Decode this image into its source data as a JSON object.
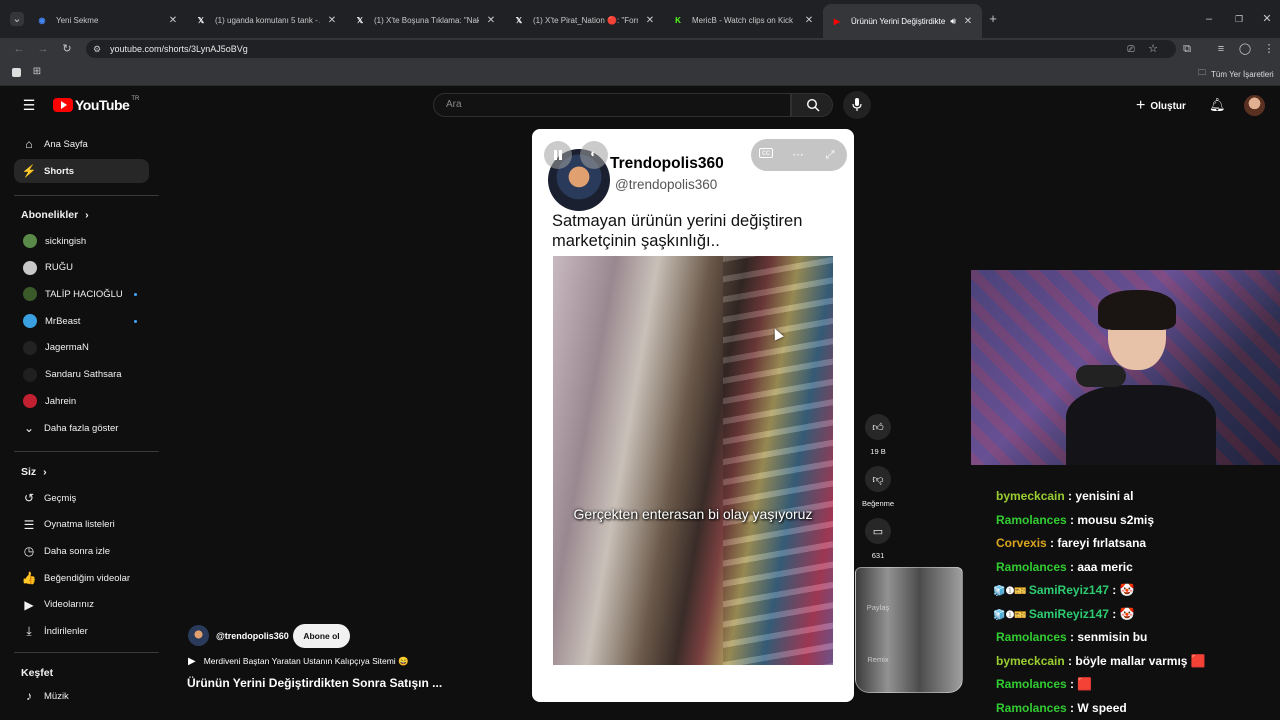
{
  "browser": {
    "tabs": [
      {
        "title": "Yeni Sekme",
        "favicon": "chrome",
        "active": false
      },
      {
        "title": "(1) uganda komutanı 5 tank - A",
        "favicon": "x",
        "active": false
      },
      {
        "title": "(1) X'te Boşuna Tıklama: \"Nakit",
        "favicon": "x",
        "active": false
      },
      {
        "title": "(1) X'te Pirat_Nation 🔴: \"Form",
        "favicon": "x",
        "active": false
      },
      {
        "title": "MericB - Watch clips on Kick",
        "favicon": "kick",
        "active": false
      },
      {
        "title": "Ürünün Yerini Değiştirdikte",
        "favicon": "youtube",
        "active": true
      }
    ],
    "url": "youtube.com/shorts/3LynAJ5oBVg",
    "bookmarks_label": "Tüm Yer İşaretleri"
  },
  "youtube": {
    "logo_text": "YouTube",
    "region": "TR",
    "search_placeholder": "Ara",
    "create_label": "Oluştur"
  },
  "sidebar": {
    "main": [
      {
        "label": "Ana Sayfa",
        "icon": "home-icon",
        "glyph": "⌂"
      },
      {
        "label": "Shorts",
        "icon": "shorts-icon",
        "glyph": "⚡"
      }
    ],
    "subscriptions_title": "Abonelikler",
    "subscriptions": [
      {
        "label": "sickingish",
        "color": "#5a8a4a",
        "live": false
      },
      {
        "label": "RUĞU",
        "color": "#c8c8c8",
        "live": false
      },
      {
        "label": "TALİP HACIOĞLU",
        "color": "#3a5a2a",
        "live": true
      },
      {
        "label": "MrBeast",
        "color": "#3aa0e0",
        "live": true
      },
      {
        "label": "JagermaN",
        "color": "#222222",
        "live": false
      },
      {
        "label": "Sandaru Sathsara",
        "color": "#202020",
        "live": false
      },
      {
        "label": "Jahrein",
        "color": "#c02030",
        "live": false
      }
    ],
    "show_more": "Daha fazla göster",
    "you_title": "Siz",
    "you_items": [
      {
        "label": "Geçmiş",
        "glyph": "↺"
      },
      {
        "label": "Oynatma listeleri",
        "glyph": "☰"
      },
      {
        "label": "Daha sonra izle",
        "glyph": "◷"
      },
      {
        "label": "Beğendiğim videolar",
        "glyph": "👍"
      },
      {
        "label": "Videolarınız",
        "glyph": "▶"
      },
      {
        "label": "İndirilenler",
        "glyph": "⤓"
      }
    ],
    "explore_title": "Keşfet",
    "explore_items": [
      {
        "label": "Müzik",
        "glyph": "♪"
      }
    ]
  },
  "short": {
    "channel_name": "Trendopolis360",
    "channel_handle": "@trendopolis360",
    "title": "Satmayan ürünün yerini değiştiren marketçinin şaşkınlığı..",
    "caption": "Gerçekten enterasan bi olay yaşıyoruz",
    "likes": "19 B",
    "dislike_label": "Beğenme",
    "comments": "631",
    "share_label": "Paylaş",
    "remix_label": "Remix"
  },
  "bottom_info": {
    "channel": "@trendopolis360",
    "subscribe": "Abone ol",
    "playlist": "Merdiveni Baştan Yaratan Ustanın Kalıpçıya Sitemi 😄",
    "title": "Ürünün Yerini Değiştirdikten Sonra Satışın ..."
  },
  "chat": [
    {
      "user": "bymeckcain",
      "color": "#9acd32",
      "msg": "yenisini al",
      "badges": ""
    },
    {
      "user": "Ramolances",
      "color": "#32cd32",
      "msg": "mousu s2miş",
      "badges": ""
    },
    {
      "user": "Corvexis",
      "color": "#daa520",
      "msg": "fareyi fırlatsana",
      "badges": ""
    },
    {
      "user": "Ramolances",
      "color": "#32cd32",
      "msg": "aaa meric",
      "badges": ""
    },
    {
      "user": "SamiReyiz147",
      "color": "#2ecc71",
      "msg": "🤡",
      "badges": "🧊❶🎫"
    },
    {
      "user": "SamiReyiz147",
      "color": "#2ecc71",
      "msg": "🤡",
      "badges": "🧊❶🎫"
    },
    {
      "user": "Ramolances",
      "color": "#32cd32",
      "msg": "senmisin bu",
      "badges": ""
    },
    {
      "user": "bymeckcain",
      "color": "#9acd32",
      "msg": "böyle mallar varmış 🟥",
      "badges": ""
    },
    {
      "user": "Ramolances",
      "color": "#32cd32",
      "msg": "🟥",
      "badges": ""
    },
    {
      "user": "Ramolances",
      "color": "#32cd32",
      "msg": "W speed",
      "badges": ""
    }
  ]
}
